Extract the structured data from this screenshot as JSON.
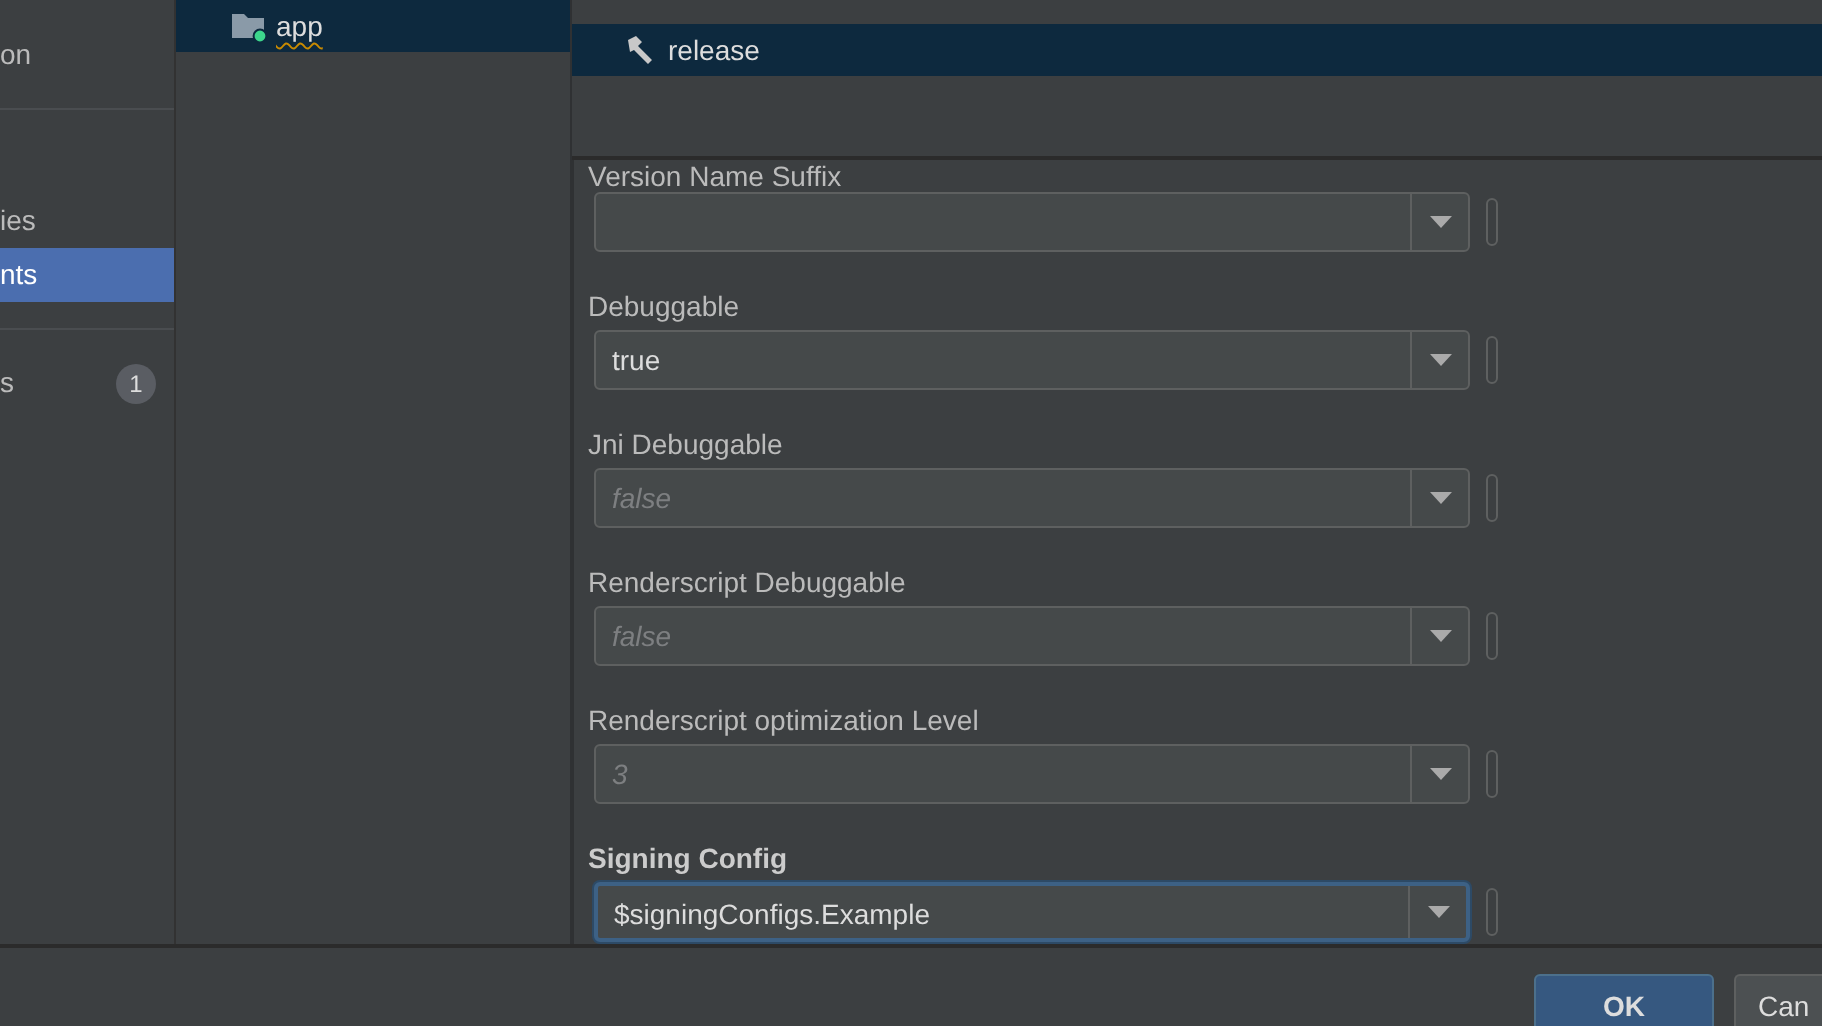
{
  "sidebar": {
    "items": [
      {
        "label": "on",
        "selected": false,
        "divider_after": true
      },
      {
        "label": "ies",
        "selected": false
      },
      {
        "label": "nts",
        "selected": true,
        "divider_after": true
      },
      {
        "label": "s",
        "selected": false,
        "badge": "1"
      }
    ]
  },
  "modules": [
    {
      "label": "app",
      "selected": true
    }
  ],
  "build_types": [
    {
      "label": "release",
      "selected": true
    }
  ],
  "fields": [
    {
      "label": "Version Name Suffix",
      "focused": false,
      "bold": false
    },
    {
      "label": "Debuggable",
      "value": "true",
      "focused": false,
      "bold": false
    },
    {
      "label": "Jni Debuggable",
      "placeholder": "false",
      "focused": false,
      "bold": false
    },
    {
      "label": "Renderscript Debuggable",
      "placeholder": "false",
      "focused": false,
      "bold": false
    },
    {
      "label": "Renderscript optimization Level",
      "placeholder": "3",
      "focused": false,
      "bold": false
    },
    {
      "label": "Signing Config",
      "value": "$signingConfigs.Example",
      "focused": true,
      "bold": true
    }
  ],
  "buttons": [
    {
      "label": "OK",
      "kind": "primary"
    },
    {
      "label": "Can",
      "kind": "secondary"
    }
  ]
}
